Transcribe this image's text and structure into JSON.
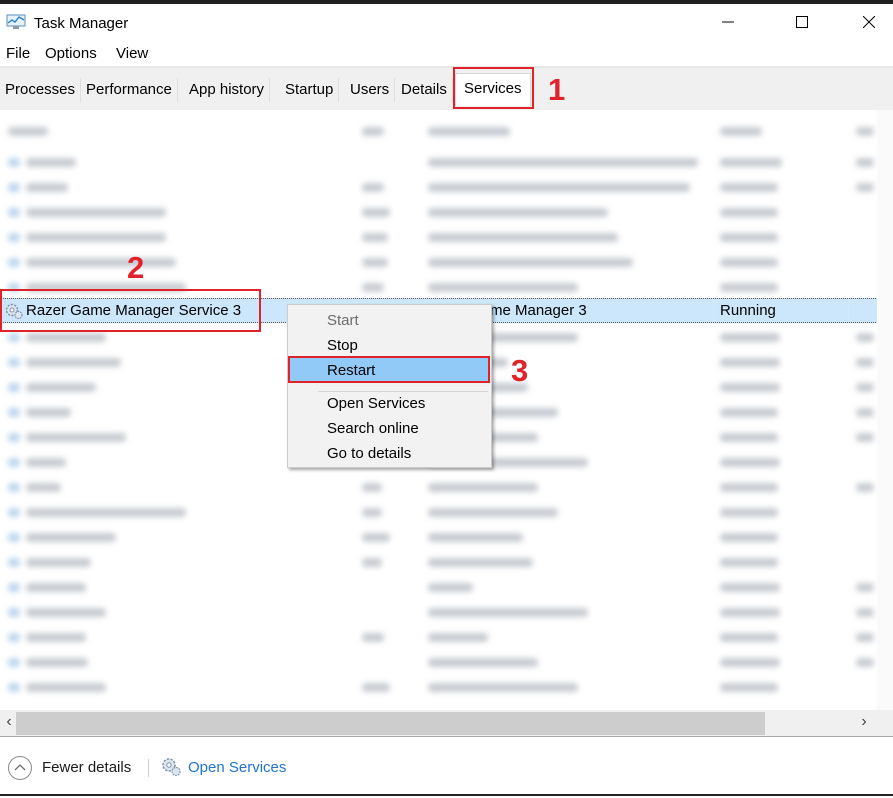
{
  "window": {
    "title": "Task Manager",
    "app_icon": "task-manager-icon",
    "controls": {
      "minimize": "—",
      "maximize": "☐",
      "close": "✕"
    }
  },
  "menu": {
    "items": [
      "File",
      "Options",
      "View"
    ]
  },
  "tabs": {
    "items": [
      "Processes",
      "Performance",
      "App history",
      "Startup",
      "Users",
      "Details",
      "Services"
    ],
    "active": "Services"
  },
  "table": {
    "columns_note": "Column headers blurred (Name, PID, Description, Status, Group)",
    "selected_row": {
      "name": "Razer Game Manager Service 3",
      "description_visible": "me Manager 3",
      "status": "Running",
      "icon": "service-gear-icon"
    },
    "blurred_rows_note": "Other service rows are intentionally blurred and unreadable"
  },
  "context_menu": {
    "items": [
      {
        "label": "Start",
        "state": "disabled"
      },
      {
        "label": "Stop",
        "state": "normal"
      },
      {
        "label": "Restart",
        "state": "highlighted"
      },
      {
        "label": "Open Services",
        "state": "normal"
      },
      {
        "label": "Search online",
        "state": "normal"
      },
      {
        "label": "Go to details",
        "state": "normal"
      }
    ]
  },
  "annotations": {
    "step1": "1",
    "step2": "2",
    "step3": "3",
    "color": "#e0222b"
  },
  "scrollbar": {
    "left_arrow": "‹",
    "right_arrow": "›"
  },
  "footer": {
    "fewer_details": "Fewer details",
    "open_services": "Open Services",
    "link_color": "#1e74d0"
  }
}
